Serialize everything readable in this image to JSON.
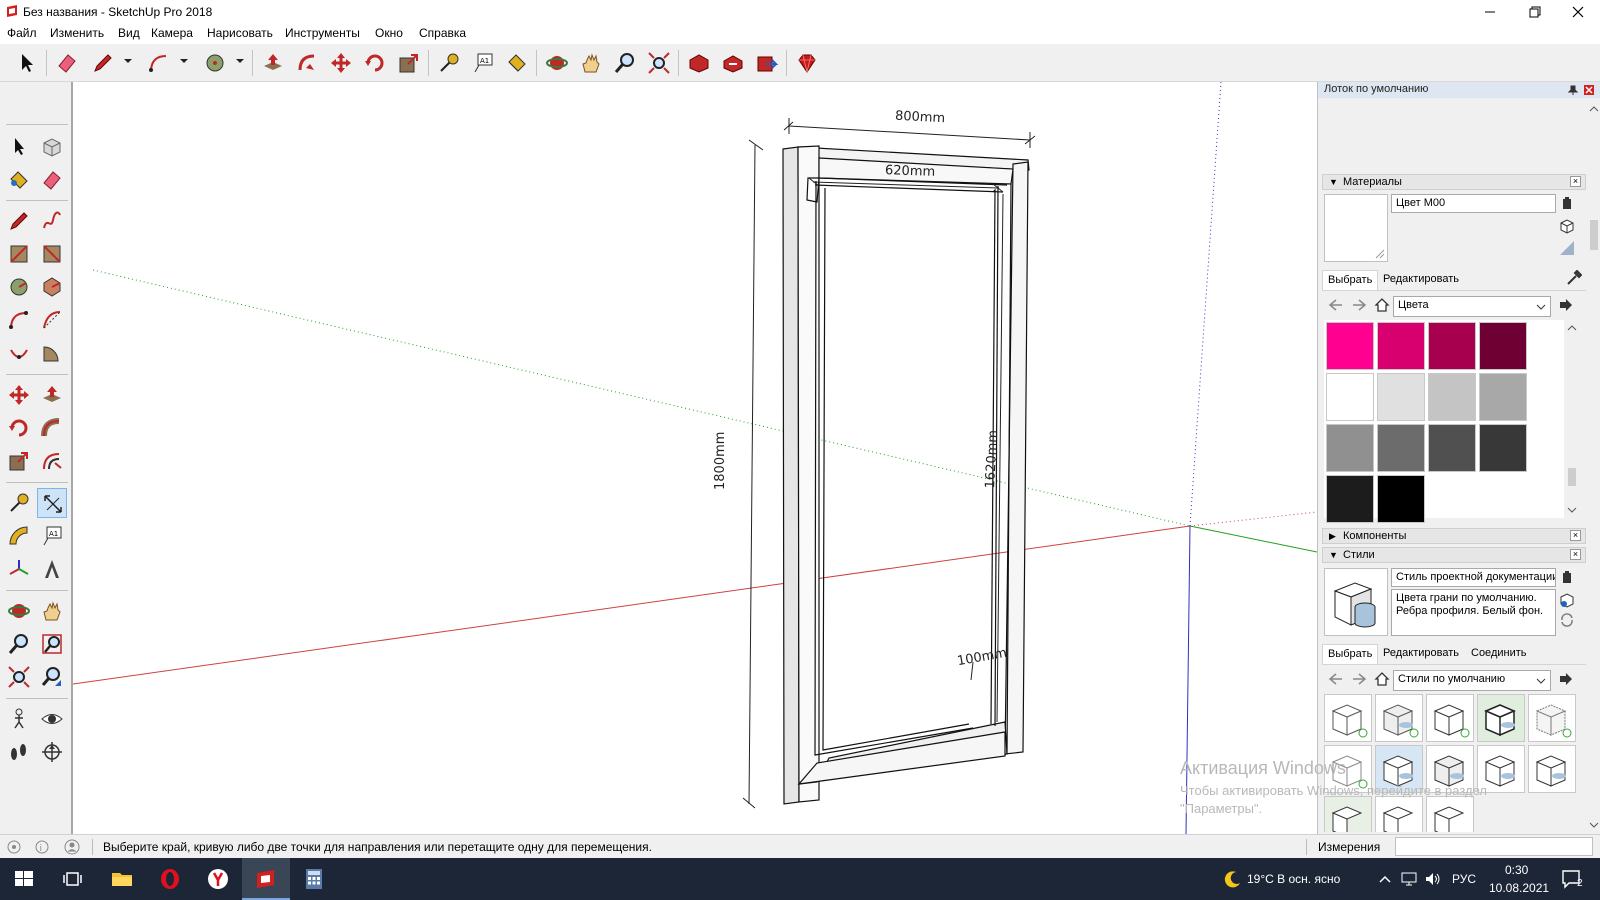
{
  "window": {
    "title": "Без названия - SketchUp Pro 2018"
  },
  "menu": [
    "Файл",
    "Изменить",
    "Вид",
    "Камера",
    "Нарисовать",
    "Инструменты",
    "Окно",
    "Справка"
  ],
  "viewport": {
    "dimensions": {
      "width_top": "800mm",
      "width_inner": "620mm",
      "height_outer": "1800mm",
      "height_inner": "1620mm",
      "thickness": "100mm"
    }
  },
  "tray": {
    "title": "Лоток по умолчанию",
    "materials": {
      "header": "Материалы",
      "name": "Цвет M00",
      "tabs": [
        "Выбрать",
        "Редактировать"
      ],
      "library": "Цвета",
      "swatches": [
        "#ff0090",
        "#d8006e",
        "#a6004e",
        "#6e0034",
        "#ffffff",
        "#e0e0e0",
        "#c4c4c4",
        "#a8a8a8",
        "#909090",
        "#6c6c6c",
        "#505050",
        "#383838",
        "#1c1c1c",
        "#000000"
      ]
    },
    "components": {
      "header": "Компоненты"
    },
    "styles": {
      "header": "Стили",
      "name": "Стиль проектной документации",
      "description": "Цвета грани по умолчанию. Ребра профиля. Белый фон.",
      "tabs": [
        "Выбрать",
        "Редактировать",
        "Соединить"
      ],
      "library": "Стили по умолчанию"
    }
  },
  "status": {
    "message": "Выберите край, кривую либо две точки для направления или перетащите одну для перемещения.",
    "measure_label": "Измерения"
  },
  "watermark": {
    "title": "Активация Windows",
    "line1": "Чтобы активировать Windows, перейдите в раздел",
    "line2": "\"Параметры\"."
  },
  "taskbar": {
    "weather": "19°C  В осн. ясно",
    "lang": "РУС",
    "time": "0:30",
    "date": "10.08.2021",
    "notifications": "2"
  },
  "colors": {
    "accent_red": "#d12020",
    "axis_red": "#d04040",
    "axis_green": "#20a020",
    "axis_blue": "#3030c0"
  }
}
